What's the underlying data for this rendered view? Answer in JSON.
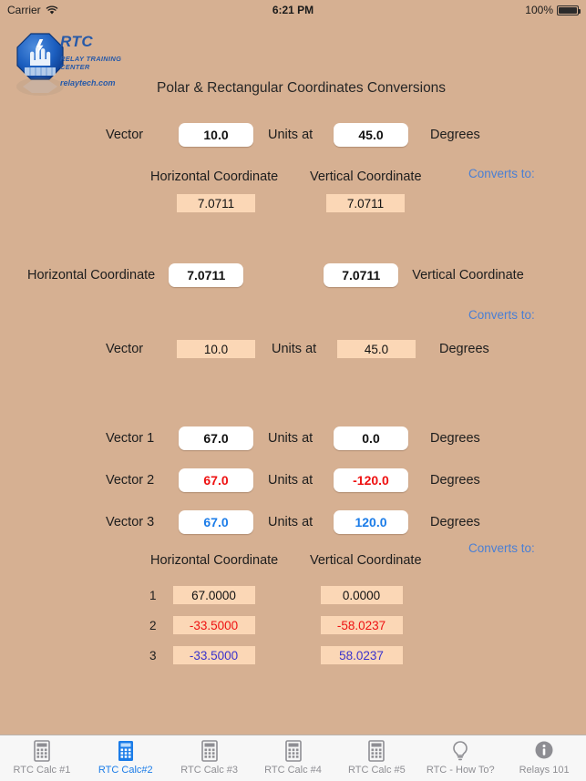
{
  "status_bar": {
    "carrier": "Carrier",
    "wifi_icon": "wifi-icon",
    "time": "6:21 PM",
    "battery_percent": "100%",
    "battery_icon": "battery-full-icon"
  },
  "header": {
    "logo": {
      "icon": "rtc-shield-logo-icon",
      "brand": "RTC",
      "tagline": "RELAY TRAINING CENTER",
      "website": "relaytech.com"
    },
    "title": "Polar & Rectangular Coordinates Conversions"
  },
  "colors": {
    "background": "#d6b092",
    "input_background": "#ffffff",
    "output_background": "#fbd7b6",
    "accent_blue": "#4a7fd4",
    "phase_a": "#111111",
    "phase_b": "#ee1111",
    "phase_c": "#1b7ce8",
    "result_phase_c": "#3a33cc",
    "tab_active": "#1b7ce8",
    "tab_inactive": "#8e8e93"
  },
  "section1": {
    "vector_label": "Vector",
    "vector_value": "10.0",
    "units_label": "Units at",
    "angle_value": "45.0",
    "degrees_label": "Degrees",
    "converts_label": "Converts to:",
    "horizontal_header": "Horizontal Coordinate",
    "vertical_header": "Vertical Coordinate",
    "horizontal_value": "7.0711",
    "vertical_value": "7.0711"
  },
  "section2": {
    "horizontal_label": "Horizontal Coordinate",
    "horizontal_value": "7.0711",
    "vertical_value": "7.0711",
    "vertical_label": "Vertical Coordinate",
    "converts_label": "Converts to:",
    "vector_label": "Vector",
    "vector_value": "10.0",
    "units_label": "Units at",
    "angle_value": "45.0",
    "degrees_label": "Degrees"
  },
  "section3": {
    "units_label": "Units at",
    "degrees_label": "Degrees",
    "converts_label": "Converts to:",
    "horizontal_header": "Horizontal Coordinate",
    "vertical_header": "Vertical Coordinate",
    "vectors": [
      {
        "label": "Vector 1",
        "magnitude": "67.0",
        "angle": "0.0"
      },
      {
        "label": "Vector 2",
        "magnitude": "67.0",
        "angle": "-120.0"
      },
      {
        "label": "Vector 3",
        "magnitude": "67.0",
        "angle": "120.0"
      }
    ],
    "results": [
      {
        "index": "1",
        "horizontal": "67.0000",
        "vertical": "0.0000"
      },
      {
        "index": "2",
        "horizontal": "-33.5000",
        "vertical": "-58.0237"
      },
      {
        "index": "3",
        "horizontal": "-33.5000",
        "vertical": "58.0237"
      }
    ]
  },
  "tabbar": {
    "items": [
      {
        "label": "RTC Calc #1",
        "icon": "calculator-icon",
        "active": false
      },
      {
        "label": "RTC Calc#2",
        "icon": "calculator-icon",
        "active": true
      },
      {
        "label": "RTC Calc #3",
        "icon": "calculator-icon",
        "active": false
      },
      {
        "label": "RTC Calc #4",
        "icon": "calculator-icon",
        "active": false
      },
      {
        "label": "RTC Calc #5",
        "icon": "calculator-icon",
        "active": false
      },
      {
        "label": "RTC - How To?",
        "icon": "lightbulb-icon",
        "active": false
      },
      {
        "label": "Relays 101",
        "icon": "info-circle-icon",
        "active": false
      }
    ]
  }
}
